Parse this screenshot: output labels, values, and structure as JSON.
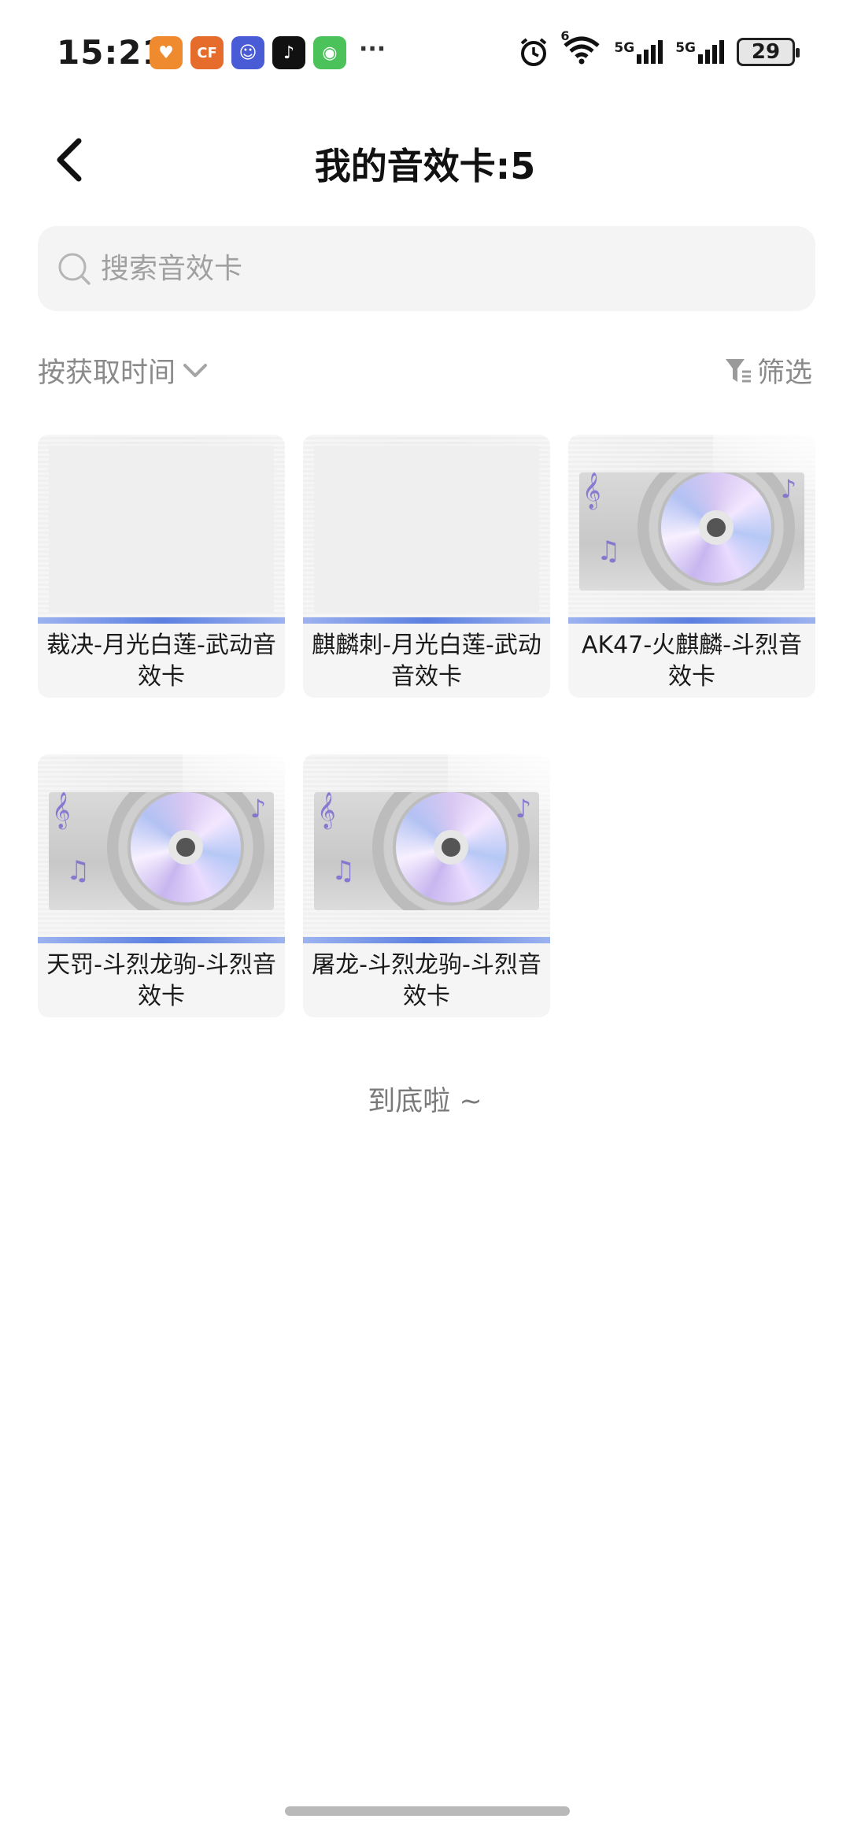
{
  "status_bar": {
    "time": "15:21",
    "apps": [
      {
        "name": "heart-app-icon",
        "color": "#f08a2e",
        "glyph": "♥"
      },
      {
        "name": "cf-app-icon",
        "color": "#e66c2c",
        "glyph": "CF"
      },
      {
        "name": "chat-app-icon",
        "color": "#4a5bd6",
        "glyph": "☺"
      },
      {
        "name": "tiktok-app-icon",
        "color": "#111111",
        "glyph": "♪"
      },
      {
        "name": "wechat-app-icon",
        "color": "#4cc35a",
        "glyph": "◉"
      }
    ],
    "more": "···",
    "network_1": "5G",
    "network_2": "5G",
    "wifi_badge": "6",
    "battery": "29"
  },
  "header": {
    "title": "我的音效卡:5"
  },
  "search": {
    "placeholder": "搜索音效卡"
  },
  "sort": {
    "label": "按获取时间"
  },
  "filter": {
    "label": "筛选"
  },
  "cards": [
    {
      "label": "裁决-月光白莲-武动音效卡",
      "art": "blank"
    },
    {
      "label": "麒麟刺-月光白莲-武动音效卡",
      "art": "blank"
    },
    {
      "label": "AK47-火麒麟-斗烈音效卡",
      "art": "disc"
    },
    {
      "label": "天罚-斗烈龙驹-斗烈音效卡",
      "art": "disc"
    },
    {
      "label": "屠龙-斗烈龙驹-斗烈音效卡",
      "art": "disc"
    }
  ],
  "footer": {
    "end_text": "到底啦 ~"
  },
  "colors": {
    "accent_bar": "#5b7fe0",
    "muted_text": "#8a8a8a",
    "search_bg": "#f4f4f4"
  }
}
